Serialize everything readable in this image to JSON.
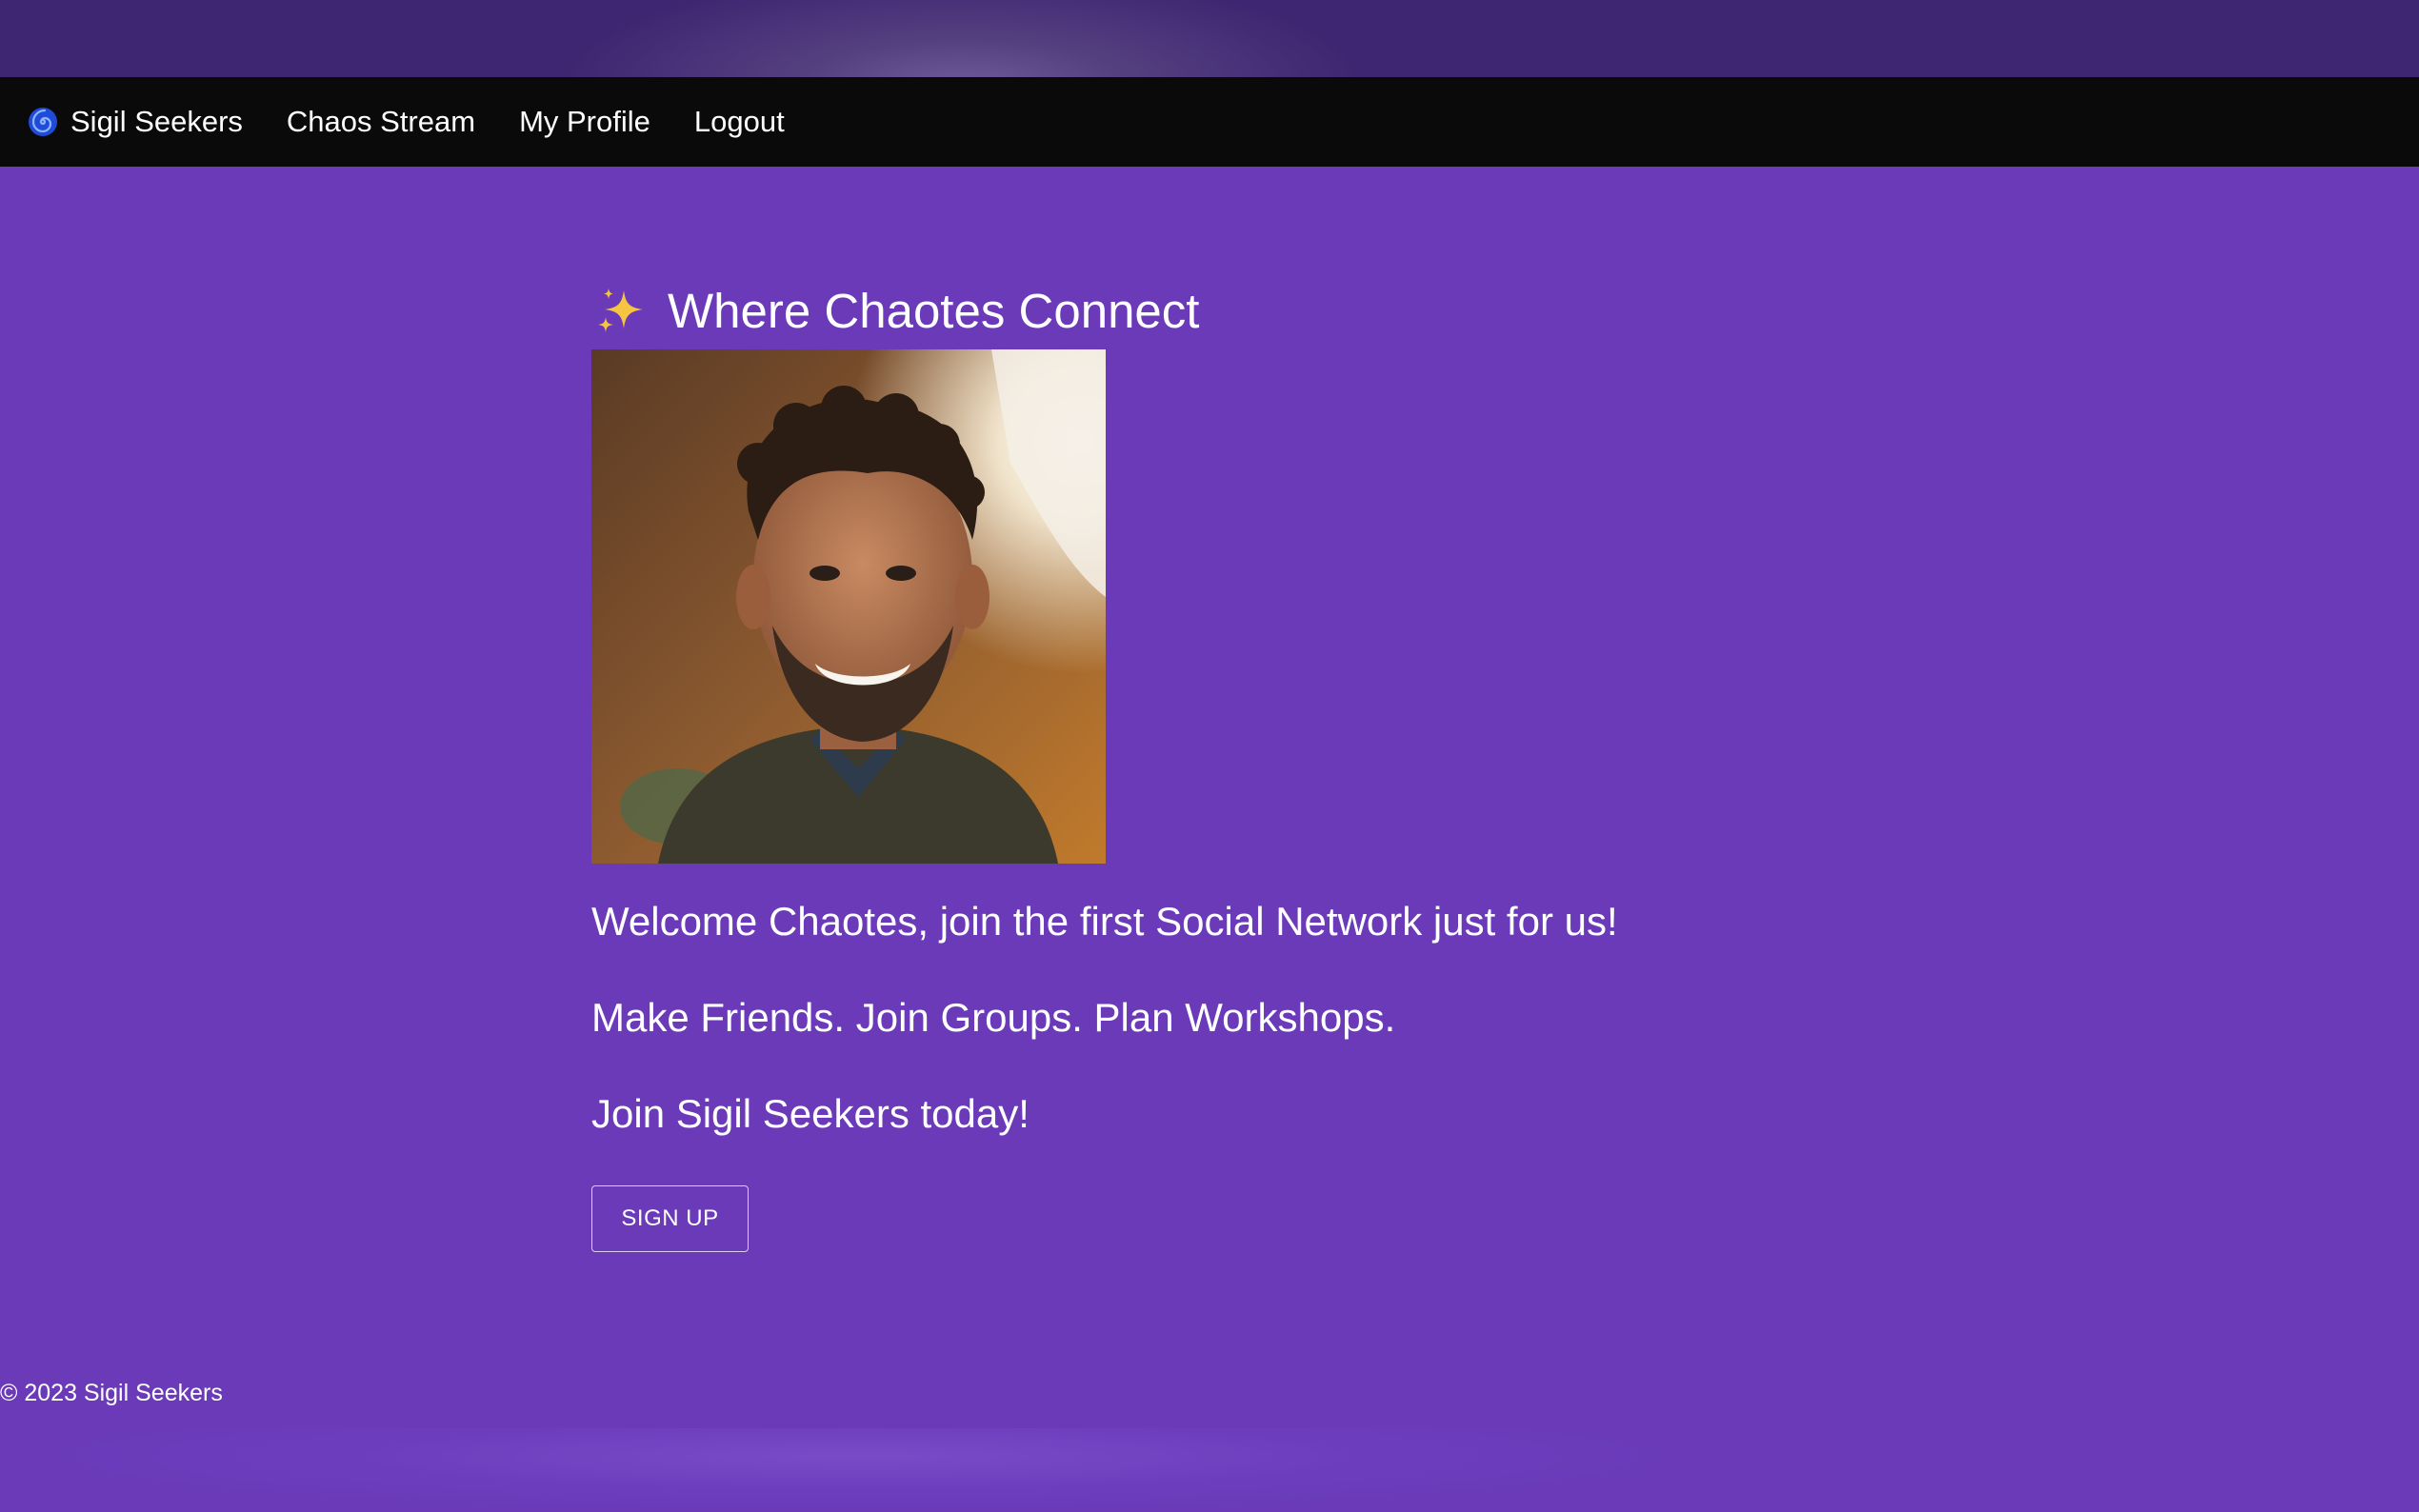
{
  "nav": {
    "brand_label": "Sigil Seekers",
    "brand_icon": "spiral-icon",
    "links": [
      {
        "label": "Chaos Stream"
      },
      {
        "label": "My Profile"
      },
      {
        "label": "Logout"
      }
    ]
  },
  "hero": {
    "headline": "Where Chaotes Connect",
    "headline_icon": "sparkles-icon",
    "photo_alt": "Smiling man with curly hair outdoors at sunset",
    "lines": [
      "Welcome Chaotes, join the first Social Network just for us!",
      "Make Friends. Join Groups. Plan Workshops.",
      "Join Sigil Seekers today!"
    ],
    "signup_label": "SIGN UP"
  },
  "footer": {
    "text": "© 2023 Sigil Seekers"
  },
  "colors": {
    "background": "#6a3ab8",
    "navbar": "#0a0a0a",
    "text": "#ffffff",
    "sparkle": "#f5c542",
    "spiral": "#1e4bd8"
  }
}
